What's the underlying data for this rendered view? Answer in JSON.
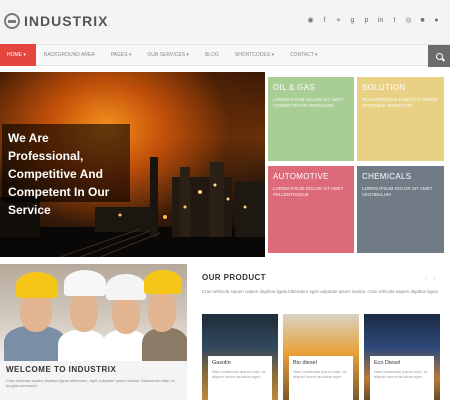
{
  "brand": {
    "name": "INDUSTRIX"
  },
  "socials": [
    "rss-icon",
    "facebook-icon",
    "twitter-icon",
    "google-plus-icon",
    "pinterest-icon",
    "linkedin-icon",
    "tumblr-icon",
    "dribbble-icon",
    "lock-icon",
    "user-icon"
  ],
  "nav": {
    "items": [
      {
        "label": "HOME ▾",
        "active": true
      },
      {
        "label": "BACKGROUND AREA"
      },
      {
        "label": "PAGES ▾"
      },
      {
        "label": "OUR SERVICES ▾"
      },
      {
        "label": "BLOG"
      },
      {
        "label": "SHORTCODES ▾"
      },
      {
        "label": "CONTACT ▾"
      }
    ]
  },
  "hero": {
    "caption_lines": [
      "We Are",
      "Professional,",
      "Competitive And",
      "Competent In Our",
      "Service"
    ]
  },
  "tiles": {
    "oil": {
      "title": "OIL & GAS",
      "text": "LOREM IPSUM DOLOR SIT AMET CONSECTETUR ADIPISCING"
    },
    "solution": {
      "title": "SOLUTION",
      "text": "PELLENTESQUE HABITANT MORBI TRISTIQUE SENECTUS"
    },
    "automotive": {
      "title": "AUTOMOTIVE",
      "text": "LOREM IPSUM DOLOR SIT AMET PELLENTESQUE"
    },
    "chemicals": {
      "title": "CHEMICALS",
      "text": "LOREM IPSUM DOLOR SIT AMET VESTIBULUM"
    }
  },
  "welcome": {
    "title": "WELCOME TO INDUSTRIX",
    "text": "Cras vehicula sapien dapibus ligula bibendum, eget vulputate ipsum lacinia. Maecenas vitae mi feugiat commodo."
  },
  "products": {
    "title": "OUR PRODUCT",
    "subtitle": "Cras vehicula sapien sapien dapibus ligula bibendum eget vulputate ipsum lacinia. Cras vehicula sapien dapibus ligula",
    "items": [
      {
        "name": "Gasolin",
        "text": "Nam commodo ipsum odio, ut aliquet lorem faucibus eget."
      },
      {
        "name": "Bio diesel",
        "text": "Nam commodo ipsum odio, ut aliquet lorem faucibus eget."
      },
      {
        "name": "Eco Diesel",
        "text": "Nam commodo ipsum odio, ut aliquet lorem faucibus eget."
      }
    ]
  },
  "colors": {
    "accent": "#e2463c",
    "tile_green": "#a8cd95",
    "tile_yellow": "#e8d184",
    "tile_pink": "#dd6a79",
    "tile_slate": "#707b86"
  }
}
